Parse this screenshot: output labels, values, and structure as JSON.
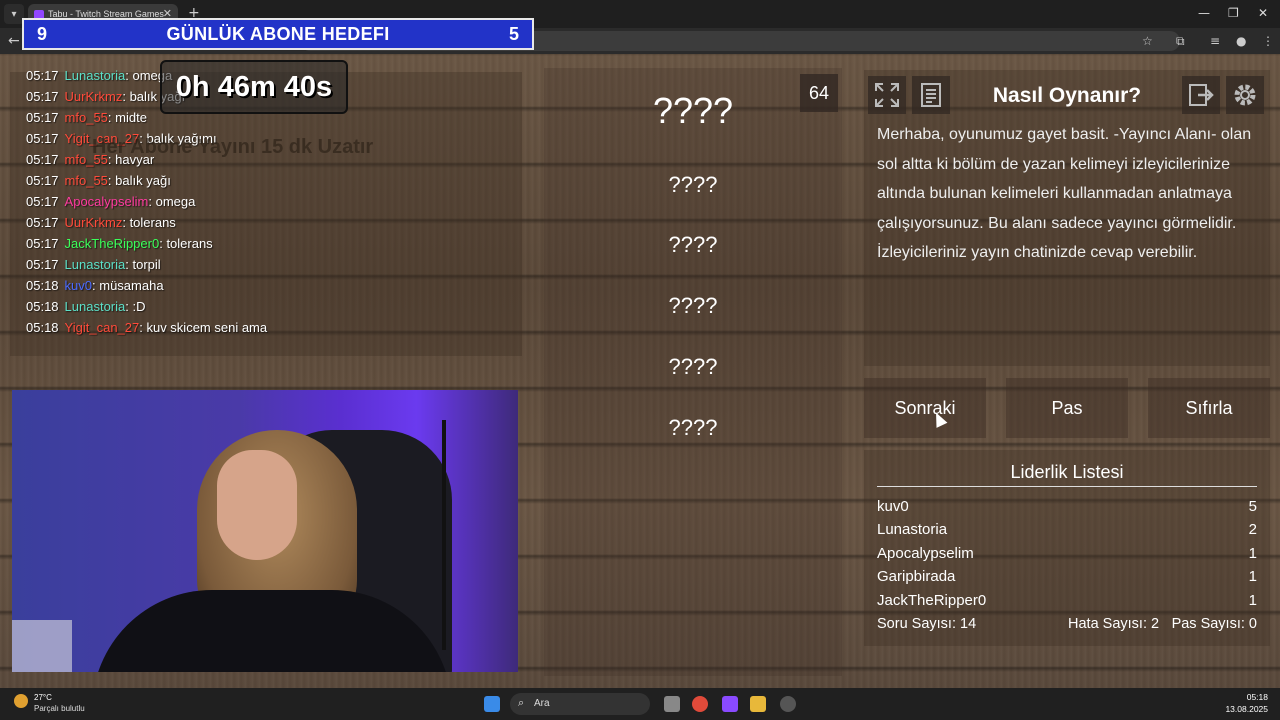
{
  "browser": {
    "tab_title": "Tabu - Twitch Stream Games"
  },
  "goal": {
    "left_number": "9",
    "title": "GÜNLÜK ABONE HEDEFI",
    "right_number": "5"
  },
  "stream": {
    "timer": "0h 46m 40s",
    "sub_extend_text": "Her Abone Yayını 15 dk Uzatır"
  },
  "chat": [
    {
      "time": "05:17",
      "user": "Lunastoria",
      "color": "#5ce0c8",
      "msg": "omega"
    },
    {
      "time": "05:17",
      "user": "UurKrkmz",
      "color": "#ff4a3a",
      "msg": "balık yağı"
    },
    {
      "time": "05:17",
      "user": "mfo_55",
      "color": "#ff4a3a",
      "msg": "midte"
    },
    {
      "time": "05:17",
      "user": "Yigit_can_27",
      "color": "#ff4a3a",
      "msg": "balık yağımı"
    },
    {
      "time": "05:17",
      "user": "mfo_55",
      "color": "#ff4a3a",
      "msg": "havyar"
    },
    {
      "time": "05:17",
      "user": "mfo_55",
      "color": "#ff4a3a",
      "msg": "balık yağı"
    },
    {
      "time": "05:17",
      "user": "Apocalypselim",
      "color": "#ff3aa0",
      "msg": "omega"
    },
    {
      "time": "05:17",
      "user": "UurKrkmz",
      "color": "#ff4a3a",
      "msg": "tolerans"
    },
    {
      "time": "05:17",
      "user": "JackTheRipper0",
      "color": "#3aff5a",
      "msg": "tolerans"
    },
    {
      "time": "05:17",
      "user": "Lunastoria",
      "color": "#5ce0c8",
      "msg": "torpil"
    },
    {
      "time": "05:18",
      "user": "kuv0",
      "color": "#4a6aff",
      "msg": "müsamaha"
    },
    {
      "time": "05:18",
      "user": "Lunastoria",
      "color": "#5ce0c8",
      "msg": ":D"
    },
    {
      "time": "05:18",
      "user": "Yigit_can_27",
      "color": "#ff4a3a",
      "msg": "kuv skicem seni ama"
    }
  ],
  "card": {
    "count": "64",
    "main_word": "????",
    "forbidden": [
      "????",
      "????",
      "????",
      "????",
      "????"
    ]
  },
  "howto": {
    "title": "Nasıl Oynanır?",
    "text": "Merhaba, oyunumuz gayet basit. -Yayıncı Alanı- olan sol altta ki bölüm de yazan kelimeyi izleyicilerinize altında bulunan kelimeleri kullanmadan anlatmaya çalışıyorsunuz. Bu alanı sadece yayıncı görmelidir. İzleyicileriniz yayın chatinizde cevap verebilir."
  },
  "buttons": {
    "next": "Sonraki",
    "pass": "Pas",
    "reset": "Sıfırla"
  },
  "leaderboard": {
    "title": "Liderlik Listesi",
    "rows": [
      {
        "name": "kuv0",
        "score": "5"
      },
      {
        "name": "Lunastoria",
        "score": "2"
      },
      {
        "name": "Apocalypselim",
        "score": "1"
      },
      {
        "name": "Garipbirada",
        "score": "1"
      },
      {
        "name": "JackTheRipper0",
        "score": "1"
      }
    ],
    "question_count": "Soru Sayısı: 14",
    "error_count": "Hata Sayısı: 2",
    "pass_count": "Pas Sayısı: 0"
  },
  "taskbar": {
    "temp": "27°C",
    "weather": "Parçalı bulutlu",
    "search_placeholder": "Ara",
    "time": "05:18",
    "date": "13.08.2025"
  }
}
